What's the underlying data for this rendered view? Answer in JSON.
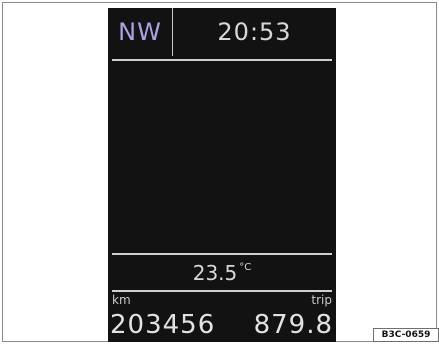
{
  "display": {
    "compass": "NW",
    "time": "20:53",
    "temperature_value": "23.5",
    "temperature_unit": "°C",
    "odometer_label": "km",
    "trip_label": "trip",
    "odometer_value": "203456",
    "trip_value": "879.8"
  },
  "figure_code": "B3C-0659"
}
